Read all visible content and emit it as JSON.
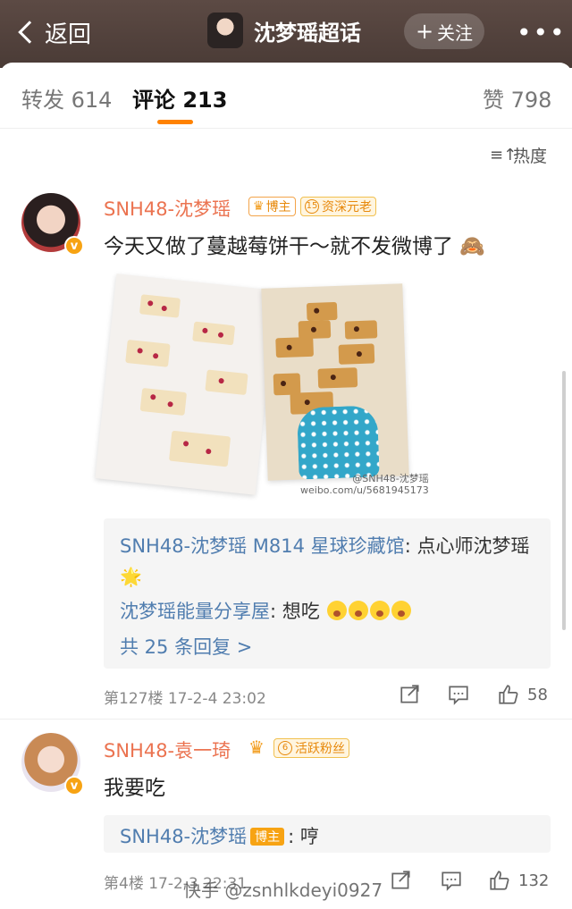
{
  "topbar": {
    "back_label": "返回",
    "title": "沈梦瑶超话",
    "follow_label": "关注",
    "more_label": "•••"
  },
  "tabs": {
    "repost": "转发 614",
    "comments": "评论 213",
    "likes": "赞 798"
  },
  "sort": {
    "label": "热度"
  },
  "comments": [
    {
      "user": "SNH48-沈梦瑶",
      "badge_host": "博主",
      "badge_level_num": "15",
      "badge_level_text": "资深元老",
      "text": "今天又做了蔓越莓饼干～就不发微博了",
      "text_emoji": "🙈",
      "watermark_line1": "@SNH48-沈梦瑶",
      "watermark_line2": "weibo.com/u/5681945173",
      "replies": [
        {
          "name": "SNH48-沈梦瑶 M814 星球珍藏馆",
          "text": ": 点心师沈梦瑶",
          "emoji": "🌟"
        },
        {
          "name": "沈梦瑶能量分享屋",
          "text": ": 想吃"
        }
      ],
      "more_replies": "共 25 条回复 >",
      "meta": "第127楼 17-2-4 23:02",
      "likes": "58"
    },
    {
      "user": "SNH48-袁一琦",
      "badge_level_num": "6",
      "badge_level_text": "活跃粉丝",
      "text": "我要吃",
      "replies": [
        {
          "name": "SNH48-沈梦瑶",
          "tag": "博主",
          "text": ": 哼"
        }
      ],
      "meta": "第4楼 17-2-3 22:31",
      "likes": "132"
    }
  ],
  "footer_watermark": "快手 @zsnhlkdeyi0927",
  "colors": {
    "accent_orange": "#ff8200",
    "username": "#eb7350",
    "reply_name": "#507daf"
  }
}
